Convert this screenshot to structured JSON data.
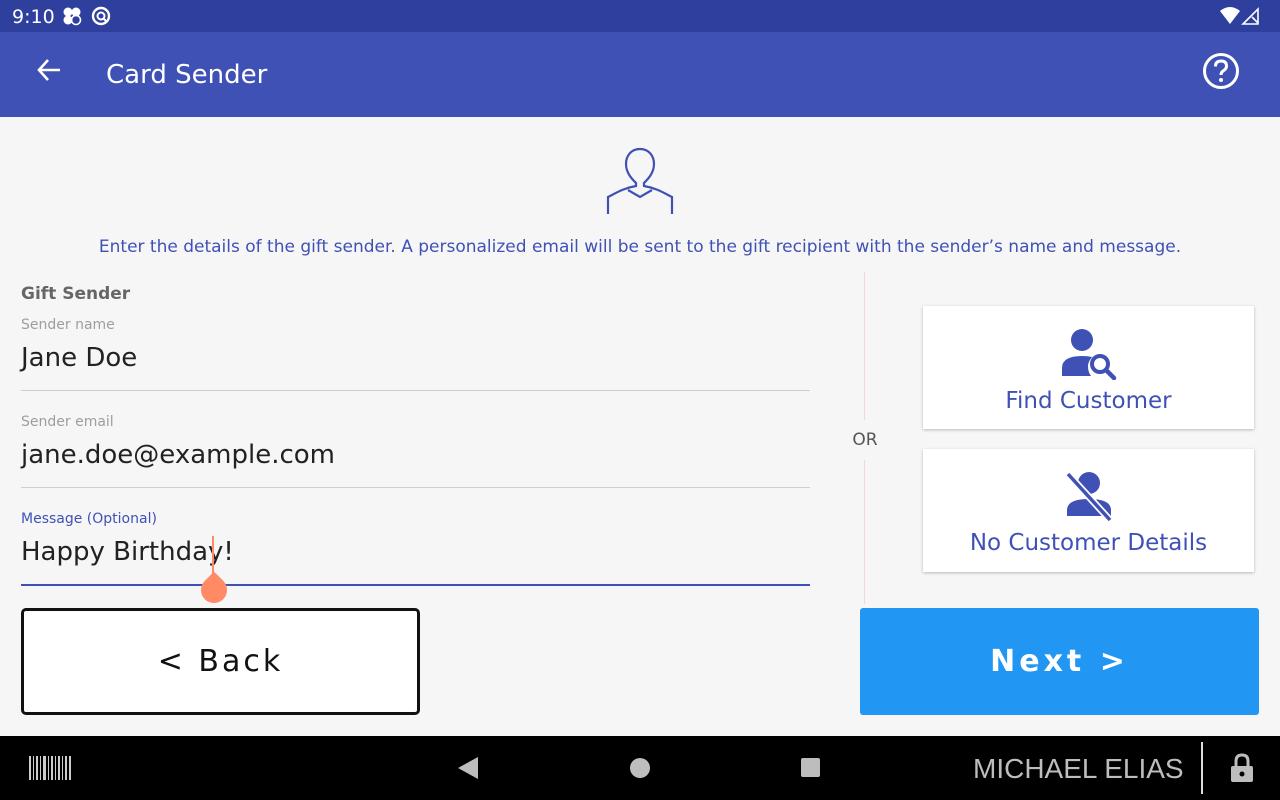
{
  "status_bar": {
    "time": "9:10",
    "left_icons": [
      "fan-icon",
      "sync-icon"
    ],
    "right_icons": [
      "wifi-icon",
      "signal-icon"
    ]
  },
  "app_bar": {
    "title": "Card Sender",
    "back_icon": "arrow-left-icon",
    "help_icon": "help-circle-icon"
  },
  "intro": {
    "icon": "person-outline-icon",
    "text": "Enter the details of the gift sender. A personalized email will be sent to the gift recipient with the sender’s name and message."
  },
  "form": {
    "section_label": "Gift Sender",
    "fields": [
      {
        "label": "Sender name",
        "value": "Jane Doe",
        "active": false
      },
      {
        "label": "Sender email",
        "value": "jane.doe@example.com",
        "active": false
      },
      {
        "label": "Message (Optional)",
        "value": "Happy Birthday!",
        "active": true
      }
    ]
  },
  "divider": {
    "or_label": "OR"
  },
  "options": [
    {
      "label": "Find Customer",
      "icon": "person-search-icon"
    },
    {
      "label": "No Customer Details",
      "icon": "person-off-icon"
    }
  ],
  "actions": {
    "back_label": "< Back",
    "next_label": "Next >"
  },
  "nav_bar": {
    "user_name": "MICHAEL ELIAS",
    "icons": [
      "barcode-icon",
      "nav-back-icon",
      "nav-home-icon",
      "nav-recents-icon",
      "lock-icon"
    ]
  },
  "colors": {
    "primary": "#3f51b5",
    "status_bar": "#2f3f9e",
    "next_button": "#2196f3",
    "cursor": "#ff8a65"
  }
}
